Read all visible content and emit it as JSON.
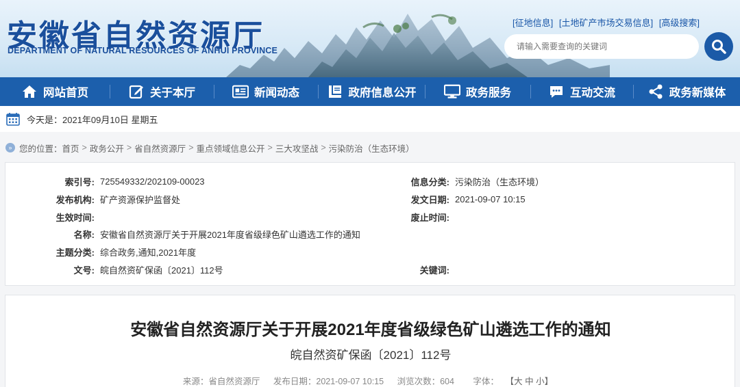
{
  "header": {
    "logo_cn": "安徽省自然资源厅",
    "logo_en": "DEPARTMENT OF NATURAL RESOURCES OF ANHUI PROVINCE",
    "top_links": [
      "[征地信息]",
      "[土地矿产市场交易信息]",
      "[高级搜索]"
    ],
    "search_placeholder": "请输入需要查询的关键词"
  },
  "nav": {
    "items": [
      {
        "label": "网站首页",
        "icon": "home-icon"
      },
      {
        "label": "关于本厅",
        "icon": "edit-icon"
      },
      {
        "label": "新闻动态",
        "icon": "news-icon"
      },
      {
        "label": "政府信息公开",
        "icon": "book-icon"
      },
      {
        "label": "政务服务",
        "icon": "monitor-icon"
      },
      {
        "label": "互动交流",
        "icon": "chat-icon"
      },
      {
        "label": "政务新媒体",
        "icon": "share-icon"
      }
    ]
  },
  "date_row": {
    "text": "今天是：2021年09月10日 星期五"
  },
  "breadcrumb": {
    "prefix": "您的位置：",
    "items": [
      "首页",
      "政务公开",
      "省自然资源厅",
      "重点领域信息公开",
      "三大攻坚战",
      "污染防治（生态环境）"
    ]
  },
  "info": {
    "index_label": "索引号:",
    "index_value": "725549332/202109-00023",
    "category_label": "信息分类:",
    "category_value": "污染防治（生态环境）",
    "org_label": "发布机构:",
    "org_value": "矿产资源保护监督处",
    "date_label": "发文日期:",
    "date_value": "2021-09-07 10:15",
    "effective_label": "生效时间:",
    "effective_value": "",
    "expire_label": "废止时间:",
    "expire_value": "",
    "name_label": "名称:",
    "name_value": "安徽省自然资源厅关于开展2021年度省级绿色矿山遴选工作的通知",
    "topic_label": "主题分类:",
    "topic_value": "综合政务,通知,2021年度",
    "docno_label": "文号:",
    "docno_value": "皖自然资矿保函〔2021〕112号",
    "keyword_label": "关键词:",
    "keyword_value": ""
  },
  "article": {
    "title": "安徽省自然资源厅关于开展2021年度省级绿色矿山遴选工作的通知",
    "subtitle": "皖自然资矿保函〔2021〕112号",
    "source": "来源：省自然资源厅",
    "publish": "发布日期：2021-09-07 10:15",
    "views": "浏览次数：604",
    "font_label": "字体：",
    "font_sizes": "【大 中 小】"
  },
  "colors": {
    "brand": "#1c5fac",
    "nav_bg": "#1c5fac",
    "link": "#1a57a8"
  }
}
